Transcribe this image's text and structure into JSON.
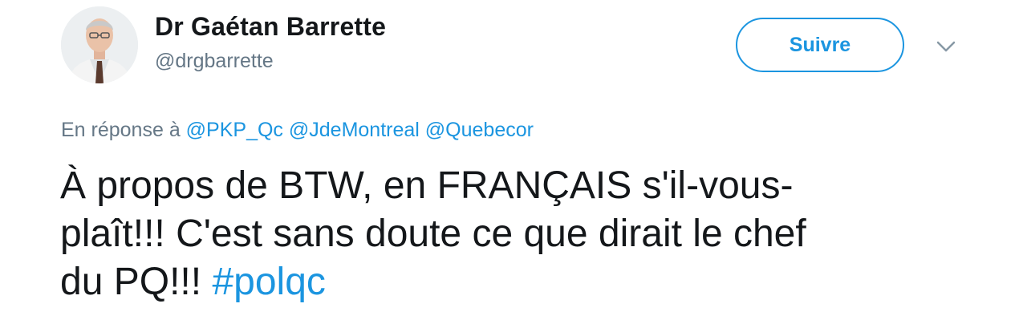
{
  "author": {
    "display_name": "Dr Gaétan Barrette",
    "handle": "@drgbarrette"
  },
  "actions": {
    "follow_label": "Suivre",
    "menu_icon": "chevron-down-icon"
  },
  "reply": {
    "prefix": "En réponse à",
    "mentions": [
      "@PKP_Qc",
      "@JdeMontreal",
      "@Quebecor"
    ]
  },
  "tweet": {
    "lines": [
      "À propos de BTW, en FRANÇAIS s'il-vous-",
      "plaît!!!  C'est sans doute ce que dirait le chef",
      "du PQ!!!"
    ],
    "hashtag": "#polqc"
  },
  "colors": {
    "link": "#1b95e0",
    "secondary": "#657786",
    "text": "#14171a"
  }
}
